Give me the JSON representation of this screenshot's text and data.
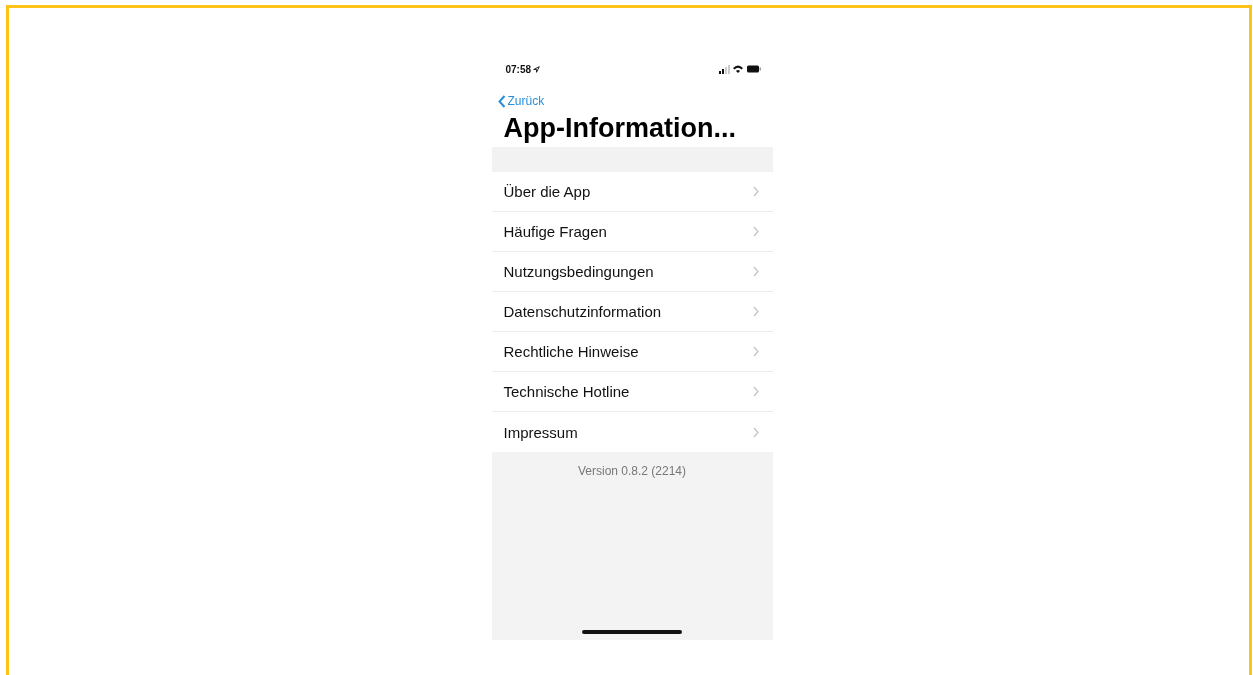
{
  "status_bar": {
    "time": "07:58"
  },
  "nav": {
    "back": "Zurück",
    "title": "App-Information..."
  },
  "menu": [
    {
      "label": "Über die App"
    },
    {
      "label": "Häufige Fragen"
    },
    {
      "label": "Nutzungsbedingungen"
    },
    {
      "label": "Datenschutzinformation"
    },
    {
      "label": "Rechtliche Hinweise"
    },
    {
      "label": "Technische Hotline"
    },
    {
      "label": "Impressum"
    }
  ],
  "footer": {
    "version": "Version 0.8.2 (2214)"
  }
}
